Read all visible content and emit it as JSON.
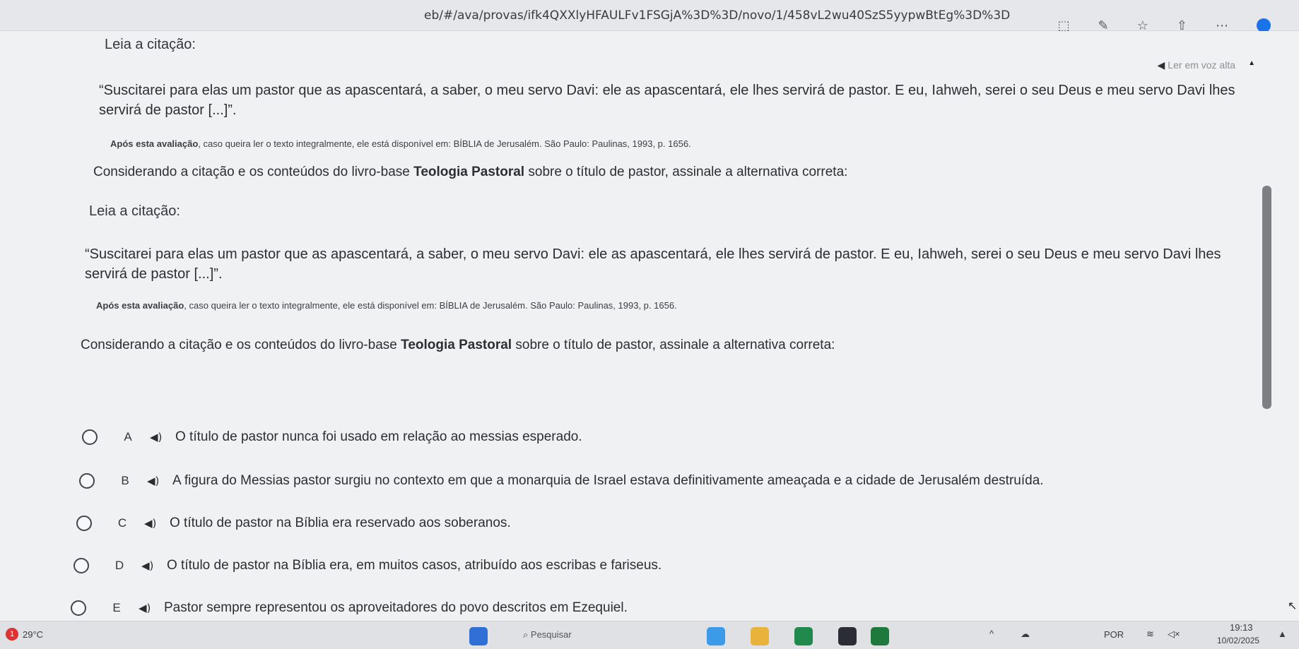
{
  "browser": {
    "url": "eb/#/ava/provas/ifk4QXXlyHFAULFv1FSGjA%3D%3D/novo/1/458vL2wu40SzS5yypwBtEg%3D%3D"
  },
  "read_aloud": {
    "label": "Ler em voz alta"
  },
  "question_top": {
    "label": "Leia a citação:",
    "quote": "“Suscitarei para elas um pastor que as apascentará, a saber, o meu servo Davi: ele as apascentará, ele lhes servirá de pastor. E eu, Iahweh, serei o seu Deus e meu servo Davi lhes servirá de pastor [...]”.",
    "ref_bold": "Após esta avaliação",
    "ref_rest": ", caso queira ler o texto integralmente, ele está disponível em: BÍBLIA de Jerusalém. São Paulo: Paulinas, 1993, p. 1656.",
    "prompt_a": "Considerando a citação e os conteúdos do livro-base ",
    "prompt_bold": "Teologia Pastoral",
    "prompt_b": " sobre o título de pastor, assinale a alternativa correta:"
  },
  "question": {
    "label": "Leia a citação:",
    "quote": "“Suscitarei para elas um pastor que as apascentará, a saber, o meu servo Davi: ele as apascentará, ele lhes servirá de pastor. E eu, Iahweh, serei o seu Deus e meu servo Davi lhes servirá de pastor [...]”.",
    "ref_bold": "Após esta avaliação",
    "ref_rest": ", caso queira ler o texto integralmente, ele está disponível em: BÍBLIA de Jerusalém. São Paulo: Paulinas, 1993, p. 1656.",
    "prompt_a": "Considerando a citação e os conteúdos do livro-base ",
    "prompt_bold": "Teologia Pastoral",
    "prompt_b": " sobre o título de pastor, assinale a alternativa correta:"
  },
  "options": [
    {
      "letter": "A",
      "text": "O título de pastor nunca foi usado em relação ao messias esperado."
    },
    {
      "letter": "B",
      "text": "A figura do Messias pastor surgiu no contexto em que a monarquia de Israel estava definitivamente ameaçada e a cidade de Jerusalém destruída."
    },
    {
      "letter": "C",
      "text": "O título de pastor na Bíblia era reservado aos soberanos."
    },
    {
      "letter": "D",
      "text": "O título de pastor na Bíblia era, em muitos casos, atribuído aos escribas e fariseus."
    },
    {
      "letter": "E",
      "text": "Pastor sempre representou os aproveitadores do povo descritos em Ezequiel."
    }
  ],
  "taskbar": {
    "weather_badge": "1",
    "temperature": "29°C",
    "search": "Pesquisar",
    "language": "POR",
    "time": "19:13",
    "date": "10/02/2025"
  }
}
